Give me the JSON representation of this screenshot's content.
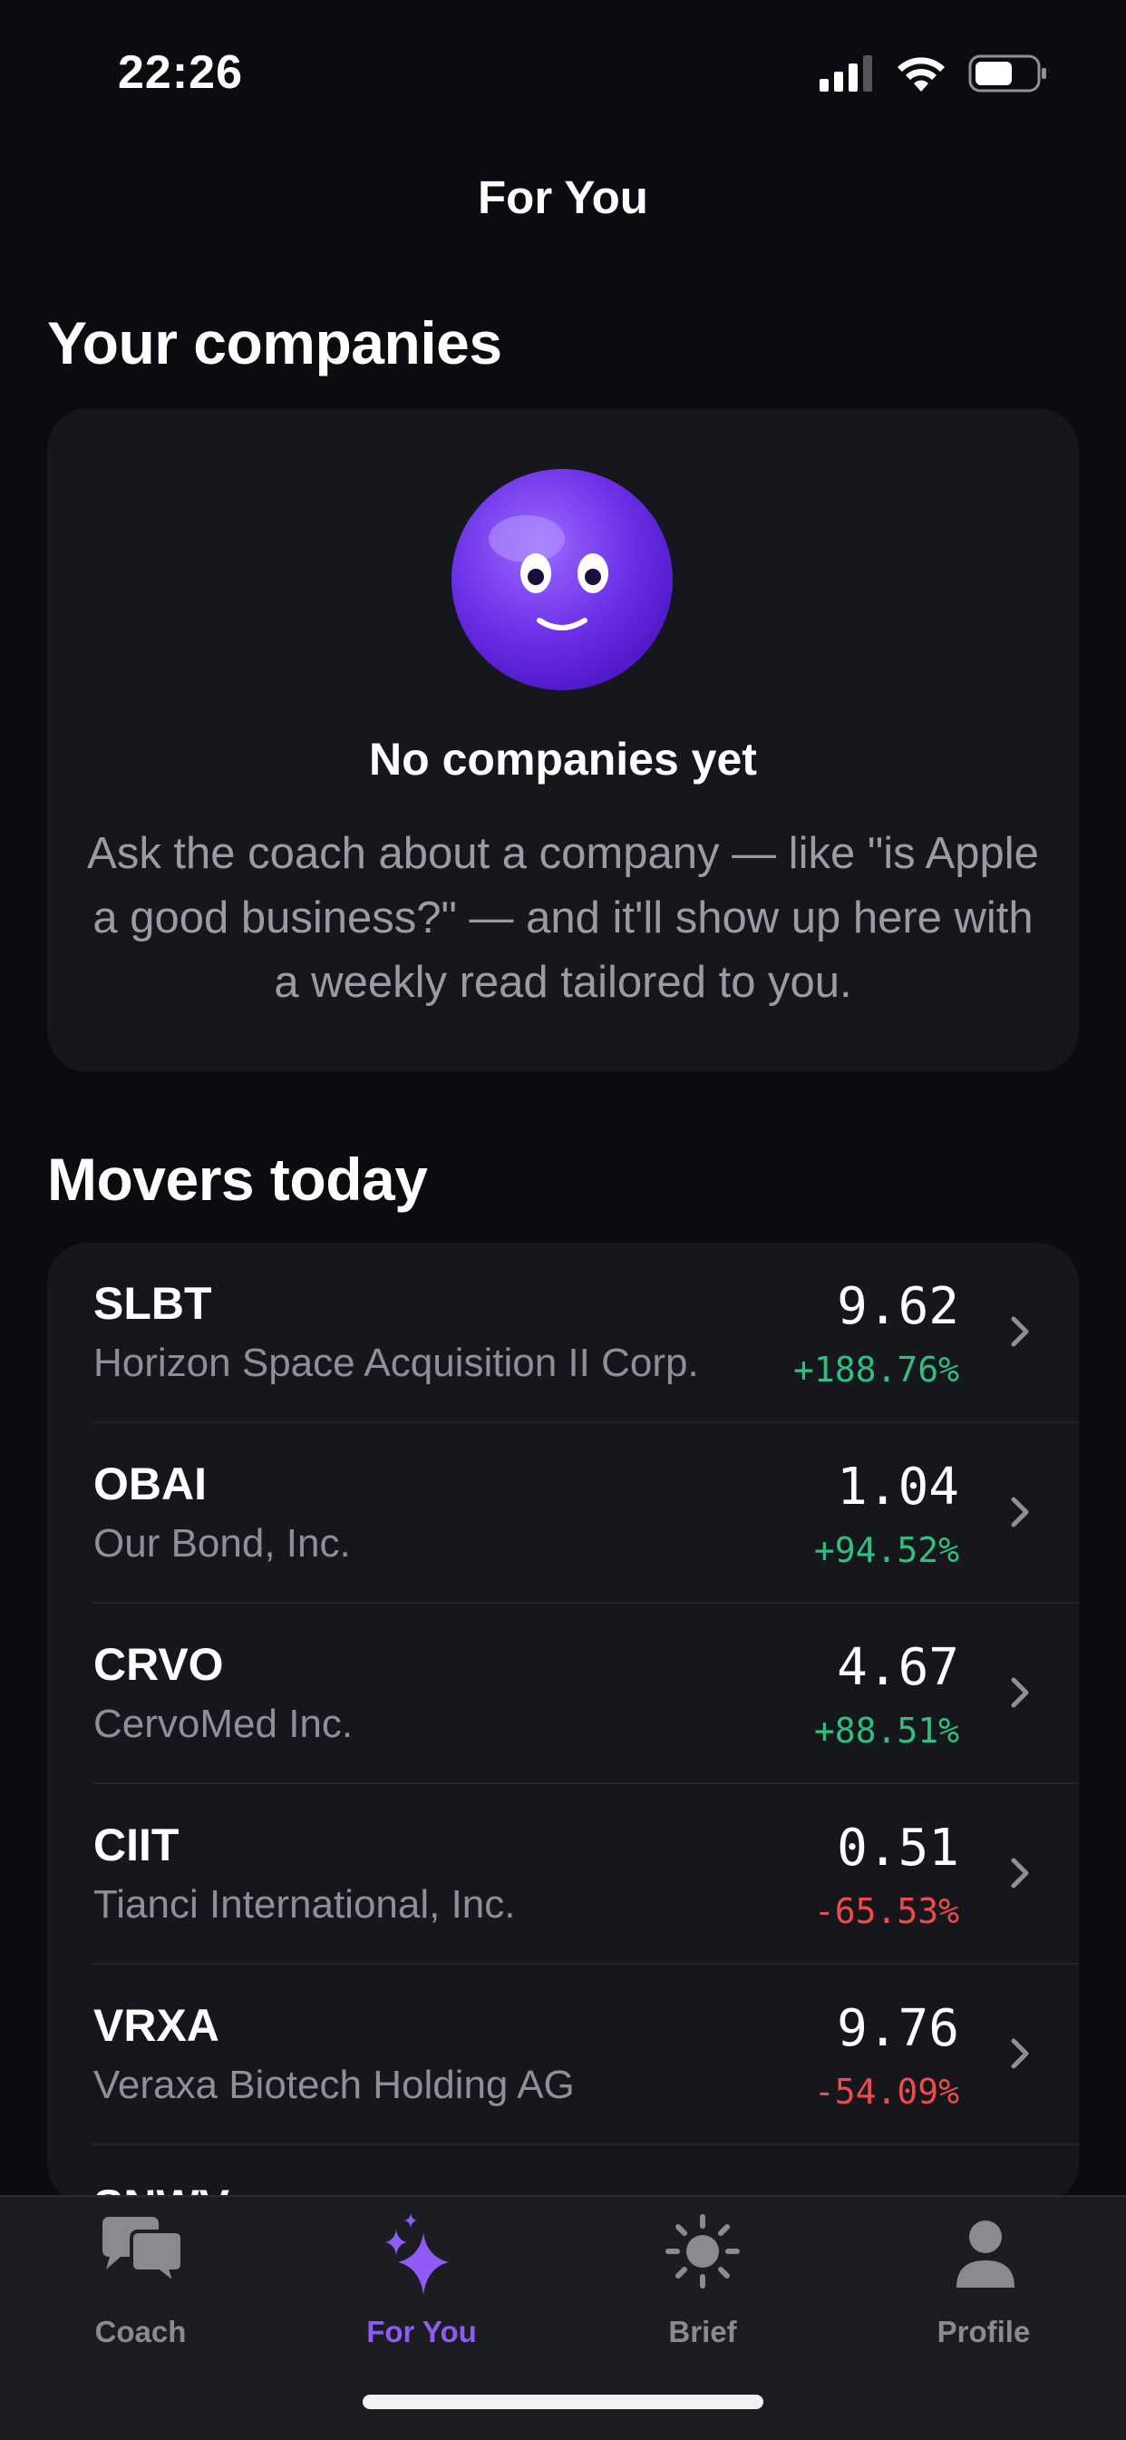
{
  "status": {
    "time": "22:26",
    "icons": [
      "cellular-signal-icon",
      "wifi-icon",
      "battery-icon"
    ]
  },
  "nav": {
    "title": "For You"
  },
  "your_companies": {
    "heading": "Your companies",
    "empty_title": "No companies yet",
    "empty_desc": "Ask the coach about a company — like \"is Apple a good business?\" — and it'll show up here with a weekly read tailored to you."
  },
  "movers": {
    "heading": "Movers today",
    "rows": [
      {
        "ticker": "SLBT",
        "company": "Horizon Space Acquisition II Corp.",
        "price": "9.62",
        "change": "+188.76%",
        "direction": "up"
      },
      {
        "ticker": "OBAI",
        "company": "Our Bond, Inc.",
        "price": "1.04",
        "change": "+94.52%",
        "direction": "up"
      },
      {
        "ticker": "CRVO",
        "company": "CervoMed Inc.",
        "price": "4.67",
        "change": "+88.51%",
        "direction": "up"
      },
      {
        "ticker": "CIIT",
        "company": "Tianci International, Inc.",
        "price": "0.51",
        "change": "-65.53%",
        "direction": "down"
      },
      {
        "ticker": "VRXA",
        "company": "Veraxa Biotech Holding AG",
        "price": "9.76",
        "change": "-54.09%",
        "direction": "down"
      },
      {
        "ticker": "SNWV",
        "company": "",
        "price": "",
        "change": "",
        "direction": "down"
      }
    ]
  },
  "tabs": [
    {
      "label": "Coach",
      "icon": "chat-bubbles-icon",
      "active": false
    },
    {
      "label": "For You",
      "icon": "sparkles-icon",
      "active": true
    },
    {
      "label": "Brief",
      "icon": "sun-icon",
      "active": false
    },
    {
      "label": "Profile",
      "icon": "person-icon",
      "active": false
    }
  ],
  "colors": {
    "accent": "#8e5cf5",
    "up": "#2fbf7f",
    "down": "#ef4b4b",
    "background": "#0b0c10",
    "card": "#15171c"
  }
}
